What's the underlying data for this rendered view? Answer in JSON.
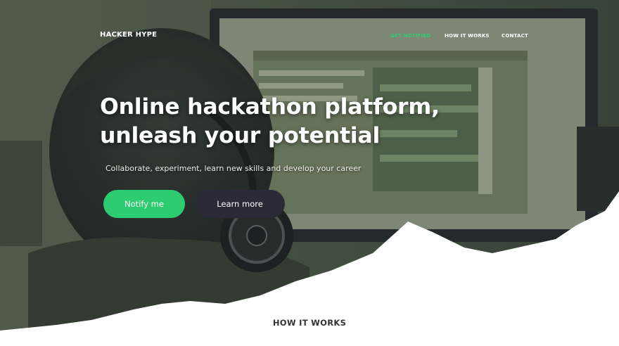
{
  "brand": {
    "logo_text": "HACKER HYPE"
  },
  "nav": {
    "items": [
      {
        "label": "GET NOTIFIED",
        "active": true
      },
      {
        "label": "HOW IT WORKS",
        "active": false
      },
      {
        "label": "CONTACT",
        "active": false
      }
    ]
  },
  "hero": {
    "headline_line1": "Online hackathon platform,",
    "headline_line2": "unleash your potential",
    "subtitle": "Collaborate, experiment, learn new skills and develop your career",
    "primary_button": "Notify me",
    "secondary_button": "Learn more"
  },
  "sections": {
    "how_it_works_title": "HOW IT WORKS"
  },
  "colors": {
    "accent": "#2ecc71",
    "dark_button": "#2b2a36",
    "background": "#ffffff"
  }
}
